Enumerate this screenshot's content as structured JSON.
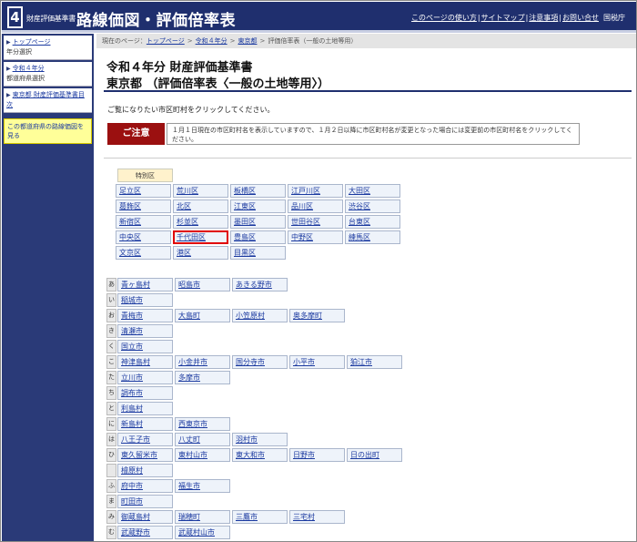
{
  "header": {
    "logo_number": "4",
    "brand_small": "財産評価基準書",
    "brand_big": "路線価図・評価倍率表",
    "links": [
      "このページの使い方",
      "サイトマップ",
      "注意事項",
      "お問い合せ"
    ],
    "agency": "国税庁"
  },
  "sidebar": {
    "block1_link": "トップページ",
    "block1_sub": "年分選択",
    "block2_link": "令和４年分",
    "block2_sub": "都道府県選択",
    "block3_link": "東京都 財産評価基準書目次",
    "yellow_link": "この都道府県の路線価図を見る"
  },
  "breadcrumb": {
    "prefix": "現在のページ：",
    "items": [
      "トップページ",
      "令和４年分",
      "東京都"
    ],
    "current": "評価倍率表（一般の土地等用）"
  },
  "main": {
    "title1": "令和４年分 財産評価基準書",
    "title2": "東京都 （評価倍率表〈一般の土地等用〉）",
    "instruction": "ご覧になりたい市区町村をクリックしてください。",
    "caution_label": "ご注意",
    "caution_text": "１月１日現在の市区町村名を表示していますので、１月２日以降に市区町村名が変更となった場合には変更前の市区町村名をクリックしてください。"
  },
  "wards": {
    "header": "特別区",
    "items": [
      "足立区",
      "荒川区",
      "板橋区",
      "江戸川区",
      "大田区",
      "葛飾区",
      "北区",
      "江東区",
      "品川区",
      "渋谷区",
      "新宿区",
      "杉並区",
      "墨田区",
      "世田谷区",
      "台東区",
      "中央区",
      "千代田区",
      "豊島区",
      "中野区",
      "練馬区",
      "文京区",
      "港区",
      "目黒区"
    ],
    "highlighted": "千代田区"
  },
  "kana_rows": [
    {
      "kana": "あ",
      "items": [
        "青ヶ島村",
        "昭島市",
        "あきる野市"
      ]
    },
    {
      "kana": "い",
      "items": [
        "稲城市"
      ]
    },
    {
      "kana": "お",
      "items": [
        "青梅市",
        "大島町",
        "小笠原村",
        "奥多摩町"
      ]
    },
    {
      "kana": "き",
      "items": [
        "清瀬市"
      ]
    },
    {
      "kana": "く",
      "items": [
        "国立市"
      ]
    },
    {
      "kana": "こ",
      "items": [
        "神津島村",
        "小金井市",
        "国分寺市",
        "小平市",
        "狛江市"
      ]
    },
    {
      "kana": "た",
      "items": [
        "立川市",
        "多摩市"
      ]
    },
    {
      "kana": "ち",
      "items": [
        "調布市"
      ]
    },
    {
      "kana": "と",
      "items": [
        "利島村"
      ]
    },
    {
      "kana": "に",
      "items": [
        "新島村",
        "西東京市"
      ]
    },
    {
      "kana": "は",
      "items": [
        "八王子市",
        "八丈町",
        "羽村市"
      ]
    },
    {
      "kana": "ひ",
      "items": [
        "東久留米市",
        "東村山市",
        "東大和市",
        "日野市",
        "日の出町"
      ]
    },
    {
      "kana": "",
      "items": [
        "檜原村"
      ]
    },
    {
      "kana": "ふ",
      "items": [
        "府中市",
        "福生市"
      ]
    },
    {
      "kana": "ま",
      "items": [
        "町田市"
      ]
    },
    {
      "kana": "み",
      "items": [
        "御蔵島村",
        "瑞穂町",
        "三鷹市",
        "三宅村"
      ]
    },
    {
      "kana": "む",
      "items": [
        "武蔵野市",
        "武蔵村山市"
      ]
    }
  ],
  "colors": {
    "header_bg": "#1f2f6e",
    "caution_bg": "#9b1010",
    "highlight": "#e00000",
    "link": "#1b3aa0"
  }
}
